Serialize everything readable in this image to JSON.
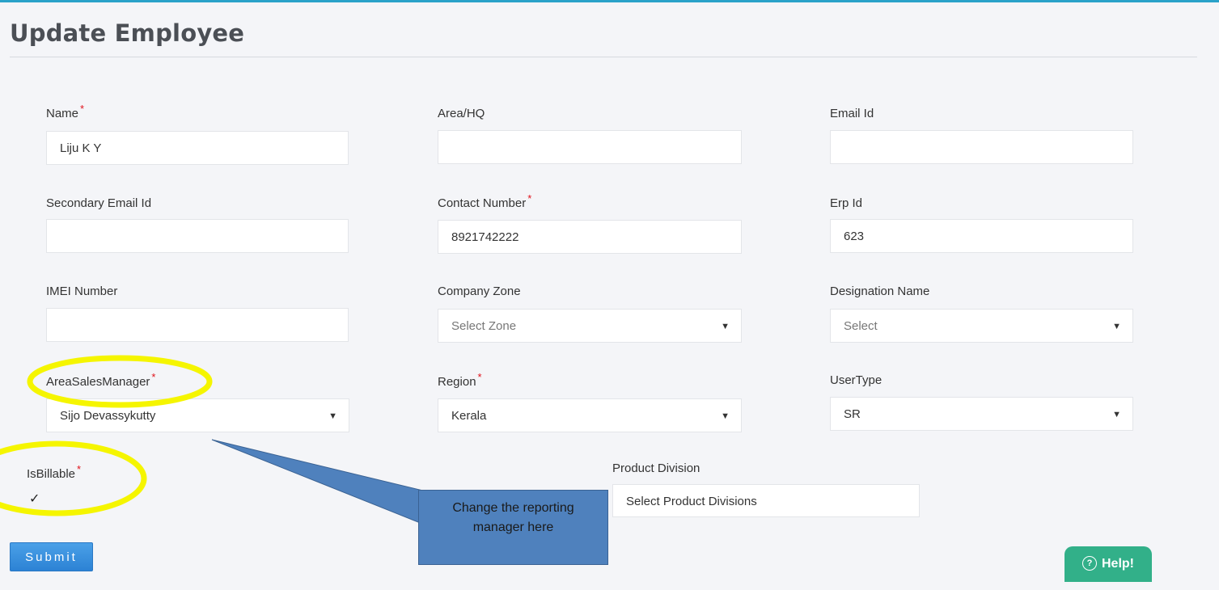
{
  "page": {
    "title": "Update Employee"
  },
  "fields": {
    "name": {
      "label": "Name",
      "value": "Liju K Y"
    },
    "area_hq": {
      "label": "Area/HQ",
      "value": ""
    },
    "email_id": {
      "label": "Email Id",
      "value": ""
    },
    "secondary_email": {
      "label": "Secondary Email Id",
      "value": ""
    },
    "contact_number": {
      "label": "Contact Number",
      "value": "8921742222"
    },
    "erp_id": {
      "label": "Erp Id",
      "value": "623"
    },
    "imei_number": {
      "label": "IMEI Number",
      "value": ""
    },
    "company_zone": {
      "label": "Company Zone",
      "value": "Select Zone"
    },
    "designation_name": {
      "label": "Designation Name",
      "value": "Select"
    },
    "area_sales_manager": {
      "label": "AreaSalesManager",
      "value": "Sijo Devassykutty"
    },
    "region": {
      "label": "Region",
      "value": "Kerala"
    },
    "user_type": {
      "label": "UserType",
      "value": "SR"
    },
    "is_billable": {
      "label": "IsBillable",
      "checked": true,
      "check_glyph": "✓"
    },
    "product_division": {
      "label": "Product Division",
      "value": "Select Product Divisions"
    }
  },
  "required_marker": "*",
  "dropdown_caret": "▼",
  "submit_label": "Submit",
  "callout": {
    "line1": "Change the reporting",
    "line2": "manager here"
  },
  "help": {
    "icon": "?",
    "label": "Help!"
  },
  "colors": {
    "accent_line": "#2aa2c9",
    "submit": "#2c82d4",
    "help": "#32b089",
    "highlight": "#f5f500",
    "callout": "#4f81bd",
    "required": "#e0121b"
  }
}
